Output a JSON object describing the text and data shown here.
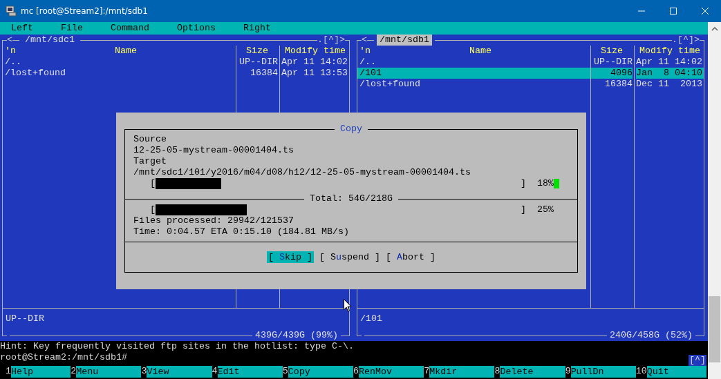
{
  "window": {
    "title": "mc [root@Stream2]:/mnt/sdb1"
  },
  "menu": [
    "Left",
    "File",
    "Command",
    "Options",
    "Right"
  ],
  "panels": [
    {
      "active": false,
      "left_marker": "<",
      "path": "/mnt/sdc1",
      "right_marker": ".[^]>",
      "columns": [
        "'n",
        "Name",
        "Size",
        "Modify time"
      ],
      "rows": [
        {
          "name": "/..",
          "size": "UP--DIR",
          "time": "Apr 11 14:02",
          "selected": false
        },
        {
          "name": "/lost+found",
          "size": "16384",
          "time": "Apr 11 13:53",
          "selected": false
        }
      ],
      "mini_status": "UP--DIR",
      "disk_usage": "439G/439G (99%)"
    },
    {
      "active": true,
      "left_marker": "<",
      "path": "/mnt/sdb1",
      "right_marker": ".[^]>",
      "columns": [
        "'n",
        "Name",
        "Size",
        "Modify time"
      ],
      "rows": [
        {
          "name": "/..",
          "size": "UP--DIR",
          "time": "Apr 11 14:02",
          "selected": false
        },
        {
          "name": "/101",
          "size": "4096",
          "time": "Jan  8 04:10",
          "selected": true
        },
        {
          "name": "/lost+found",
          "size": "16384",
          "time": "Dec 11  2013",
          "selected": false
        }
      ],
      "mini_status": "/101",
      "disk_usage": "240G/458G (52%)"
    }
  ],
  "dialog": {
    "title": "Copy",
    "source_label": "Source",
    "source": "12-25-05-mystream-00001404.ts",
    "target_label": "Target",
    "target": "/mnt/sdc1/101/y2016/m04/d08/h12/12-25-05-mystream-00001404.ts",
    "file_progress": {
      "open": "[",
      "close": "]",
      "level": 0.18,
      "reading": "18%"
    },
    "total": "Total: 54G/218G",
    "total_progress": {
      "open": "[",
      "close": "]",
      "level": 0.25,
      "reading": "25%"
    },
    "files_processed": "Files processed: 29942/121537",
    "time": "Time: 0:04.57 ETA 0:15.10 (184.81 MB/s)",
    "buttons": [
      {
        "before": "[ ",
        "hotkey": "S",
        "after": "kip ]",
        "selected": true
      },
      {
        "before": "[ S",
        "hotkey": "u",
        "after": "spend ]",
        "selected": false
      },
      {
        "before": "[ ",
        "hotkey": "A",
        "after": "bort ]",
        "selected": false
      }
    ]
  },
  "hint": "Hint: Key frequently visited ftp sites in the hotlist: type C-\\.",
  "command_line": {
    "prompt": "root@Stream2:/mnt/sdb1#",
    "history_button": "[^]"
  },
  "function_keys": [
    {
      "number": "1",
      "label": "Help"
    },
    {
      "number": "2",
      "label": "Menu"
    },
    {
      "number": "3",
      "label": "View"
    },
    {
      "number": "4",
      "label": "Edit"
    },
    {
      "number": "5",
      "label": "Copy"
    },
    {
      "number": "6",
      "label": "RenMov"
    },
    {
      "number": "7",
      "label": "Mkdir"
    },
    {
      "number": "8",
      "label": "Delete"
    },
    {
      "number": "9",
      "label": "PullDn"
    },
    {
      "number": "10",
      "label": "Quit"
    }
  ]
}
